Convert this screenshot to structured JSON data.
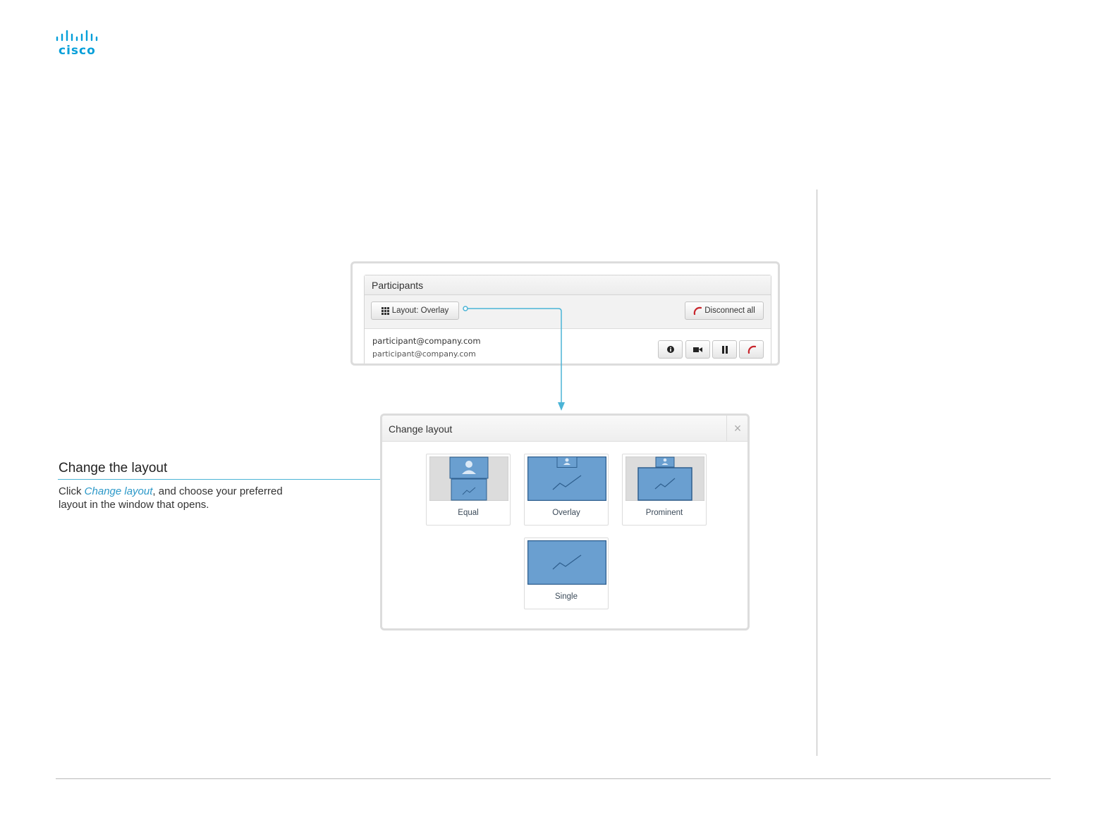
{
  "brand": {
    "logo_text": "cisco",
    "color": "#049fd9"
  },
  "description": {
    "title": "Change the layout",
    "body_prefix": "Click ",
    "body_link": "Change layout",
    "body_suffix": ", and choose your preferred layout in the window that opens."
  },
  "participants": {
    "header": "Participants",
    "layout_button": "Layout: Overlay",
    "disconnect_button": "Disconnect all",
    "participant": {
      "name": "participant@company.com",
      "uri": "participant@company.com"
    },
    "row_actions": [
      "info-icon",
      "video-icon",
      "pause-icon",
      "hangup-icon"
    ]
  },
  "change_layout": {
    "title": "Change layout",
    "close_symbol": "×",
    "options": {
      "equal": "Equal",
      "overlay": "Overlay",
      "prominent": "Prominent",
      "single": "Single"
    }
  },
  "colors": {
    "accent": "#4bb4d6",
    "thumb_blue": "#6a9fd0",
    "thumb_border": "#2f5f8e",
    "thumb_gray": "#dcdcdc",
    "hangup_red": "#c8252c"
  }
}
